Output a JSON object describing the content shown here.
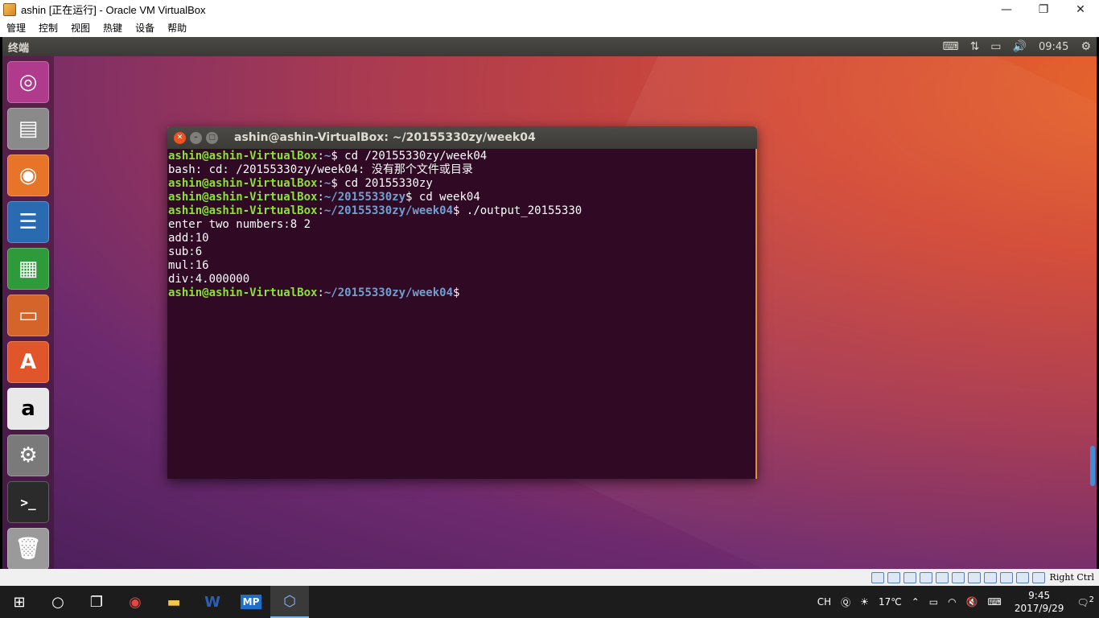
{
  "host": {
    "title": "ashin [正在运行] - Oracle VM VirtualBox",
    "menu": [
      "管理",
      "控制",
      "视图",
      "热键",
      "设备",
      "帮助"
    ],
    "window_buttons": [
      "—",
      "❐",
      "✕"
    ],
    "status_key": "Right Ctrl"
  },
  "guest": {
    "topbar": {
      "title": "终端",
      "time": "09:45"
    },
    "launcher": [
      {
        "name": "ubuntu-dash",
        "glyph": "◎",
        "color": "#b03a8c"
      },
      {
        "name": "files",
        "glyph": "▤",
        "color": "#8a8a8a"
      },
      {
        "name": "firefox",
        "glyph": "◉",
        "color": "#e8742a"
      },
      {
        "name": "libreoffice-writer",
        "glyph": "☰",
        "color": "#2a6ab0"
      },
      {
        "name": "libreoffice-calc",
        "glyph": "▦",
        "color": "#2e9a3a"
      },
      {
        "name": "libreoffice-impress",
        "glyph": "▭",
        "color": "#d4642a"
      },
      {
        "name": "software-center",
        "glyph": "A",
        "color": "#e0562a"
      },
      {
        "name": "amazon",
        "glyph": "a",
        "color": "#e8e8e8"
      },
      {
        "name": "system-settings",
        "glyph": "⚙",
        "color": "#7a7a7a"
      },
      {
        "name": "terminal",
        "glyph": ">_",
        "color": "#2b2b2b"
      },
      {
        "name": "trash",
        "glyph": "🗑",
        "color": "#9a9a9a"
      }
    ],
    "terminal": {
      "title": "ashin@ashin-VirtualBox: ~/20155330zy/week04",
      "lines": [
        {
          "user": "ashin@ashin-VirtualBox",
          "path": "~",
          "rest": "$ cd /20155330zy/week04"
        },
        {
          "text": "bash: cd: /20155330zy/week04: 没有那个文件或目录"
        },
        {
          "user": "ashin@ashin-VirtualBox",
          "path": "~",
          "rest": "$ cd 20155330zy"
        },
        {
          "user": "ashin@ashin-VirtualBox",
          "path": "~/20155330zy",
          "rest": "$ cd week04"
        },
        {
          "user": "ashin@ashin-VirtualBox",
          "path": "~/20155330zy/week04",
          "rest": "$ ./output_20155330"
        },
        {
          "text": "enter two numbers:8 2"
        },
        {
          "text": "add:10"
        },
        {
          "text": "sub:6"
        },
        {
          "text": "mul:16"
        },
        {
          "text": "div:4.000000"
        },
        {
          "user": "ashin@ashin-VirtualBox",
          "path": "~/20155330zy/week04",
          "rest": "$"
        }
      ]
    }
  },
  "taskbar": {
    "apps": [
      "chrome",
      "file-explorer",
      "word",
      "mp",
      "virtualbox"
    ],
    "ime": "CH",
    "weather": "17℃",
    "time": "9:45",
    "date": "2017/9/29",
    "notifications": "2"
  },
  "colors": {
    "term_bg": "#300a24",
    "prompt_user": "#8ae234",
    "prompt_path": "#729fcf",
    "ubuntu_orange": "#e95420"
  }
}
